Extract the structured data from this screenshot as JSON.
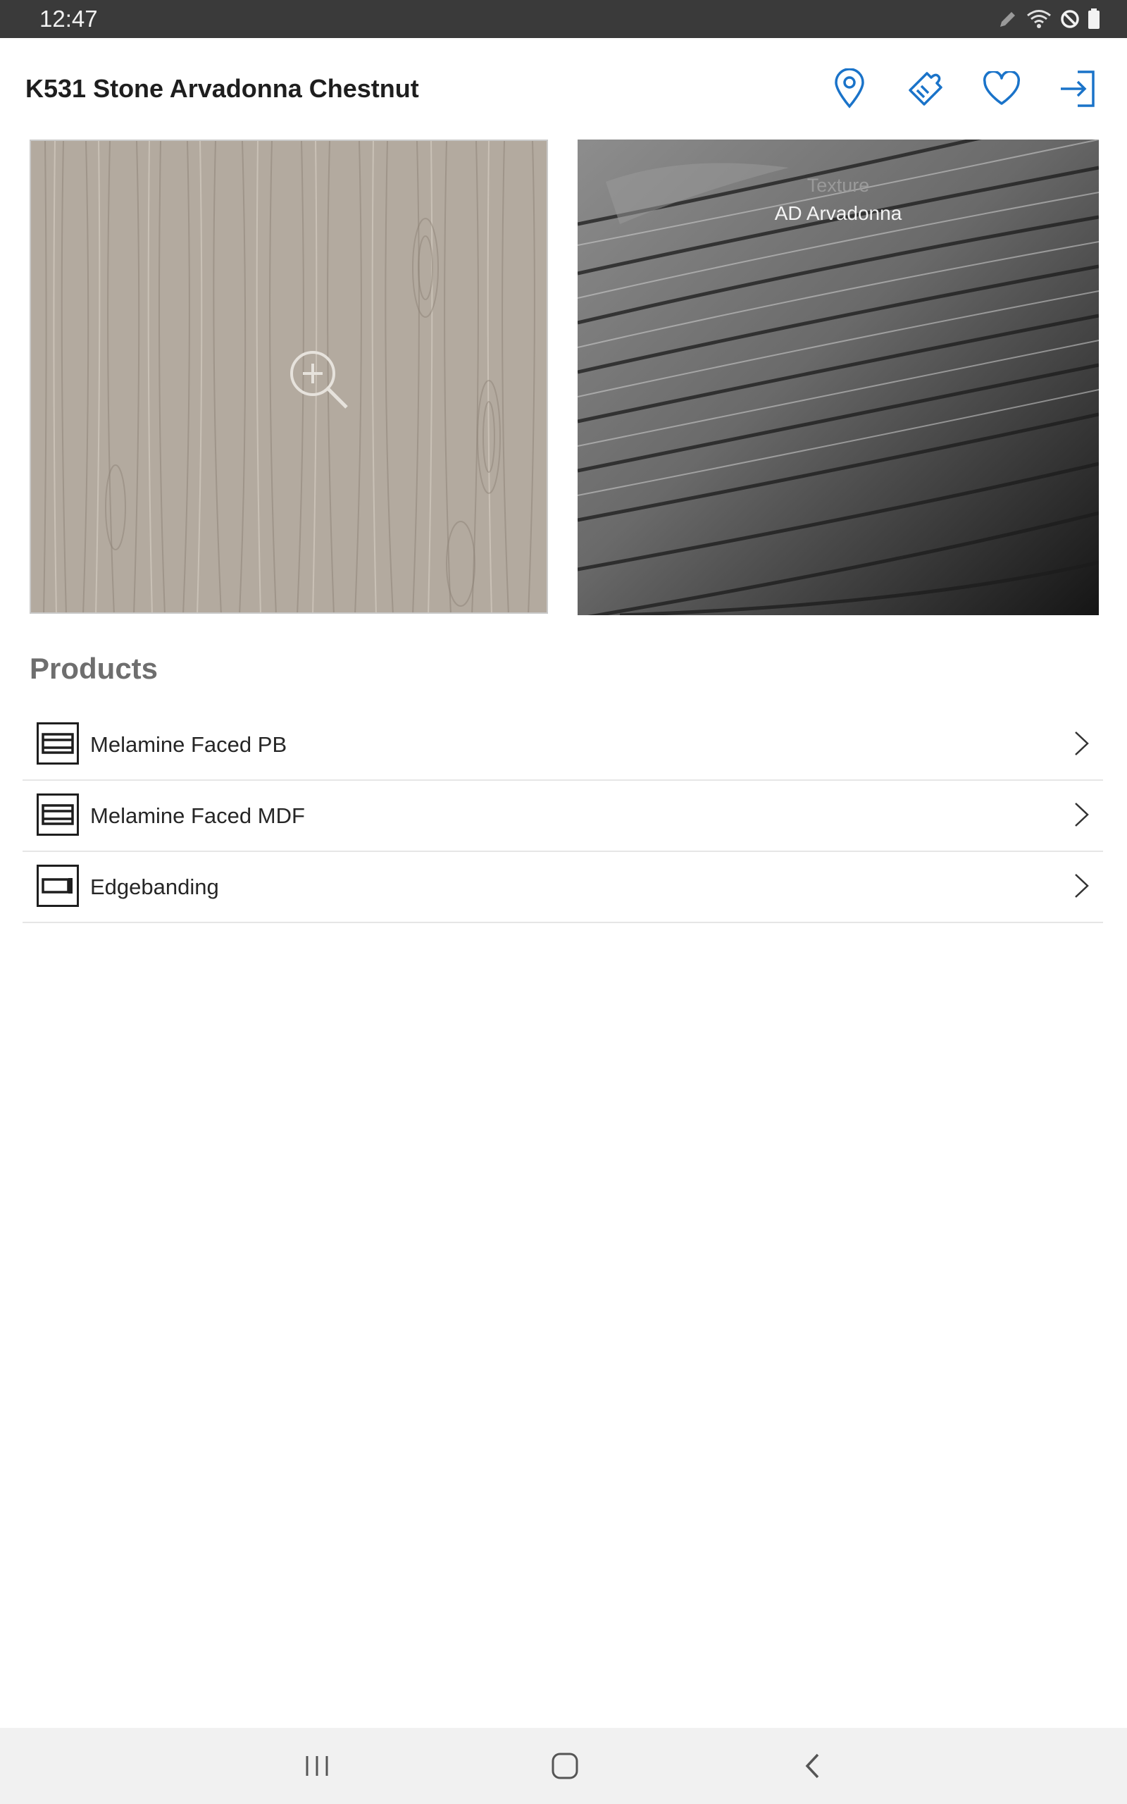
{
  "status_bar": {
    "time": "12:47",
    "icons": [
      "pen-icon",
      "wifi-icon",
      "do-not-disturb-icon",
      "battery-icon"
    ]
  },
  "header": {
    "title": "K531 Stone Arvadonna Chestnut",
    "actions": [
      {
        "name": "location-pin-icon"
      },
      {
        "name": "tag-icon"
      },
      {
        "name": "heart-icon"
      },
      {
        "name": "sign-in-icon"
      }
    ],
    "accent_color": "#1a73c9"
  },
  "swatch": {
    "zoom_icon": "zoom-in-icon"
  },
  "texture": {
    "label": "Texture",
    "name": "AD Arvadonna"
  },
  "products": {
    "title": "Products",
    "items": [
      {
        "label": "Melamine Faced PB",
        "icon": "board-icon"
      },
      {
        "label": "Melamine Faced MDF",
        "icon": "board-icon"
      },
      {
        "label": "Edgebanding",
        "icon": "edgeband-icon"
      }
    ]
  },
  "nav_bar": {
    "buttons": [
      "recent-apps-icon",
      "home-icon",
      "back-icon"
    ]
  }
}
